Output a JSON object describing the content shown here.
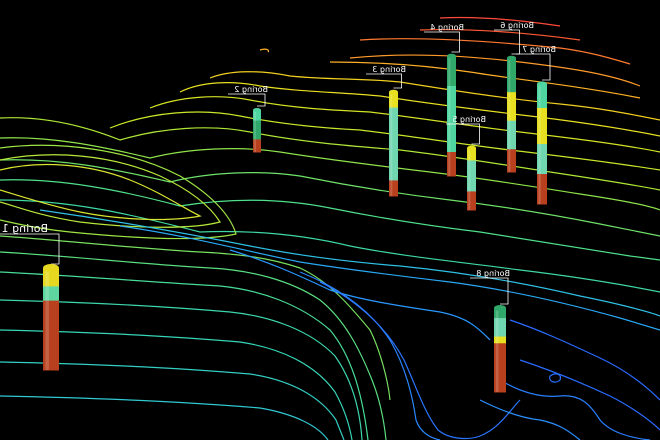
{
  "viewport": {
    "background": "#000000",
    "palette": [
      "#ff4a3a",
      "#ff7a30",
      "#ffb028",
      "#f2e021",
      "#c8e82a",
      "#8ee44a",
      "#4fe08a",
      "#36d6b8",
      "#2fc0e6",
      "#2a98ff",
      "#2a6cff"
    ]
  },
  "boreholes": [
    {
      "label": "Boring 1"
    },
    {
      "label": "Boring 2"
    },
    {
      "label": "Boring 3"
    },
    {
      "label": "Boring 4"
    },
    {
      "label": "Boring 5"
    },
    {
      "label": "Boring 6"
    },
    {
      "label": "Boring 7"
    },
    {
      "label": "Boring 8"
    }
  ]
}
